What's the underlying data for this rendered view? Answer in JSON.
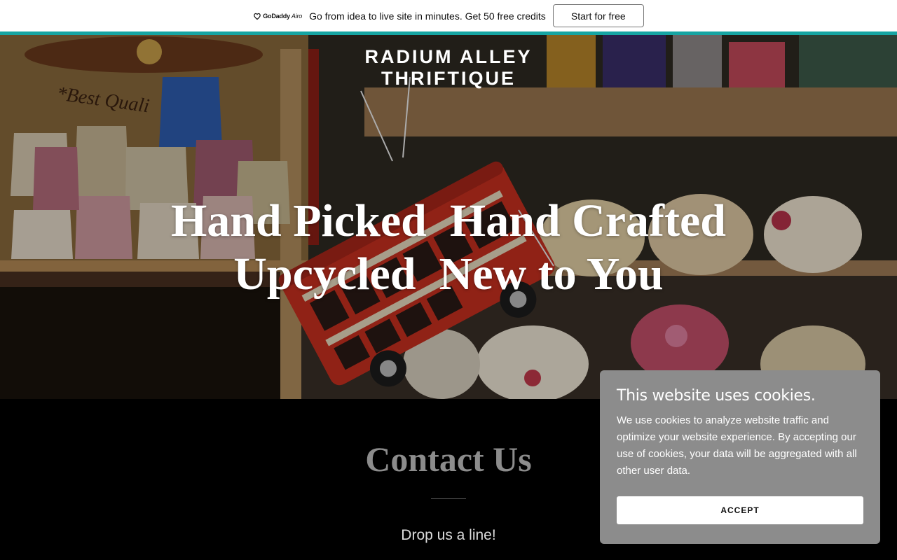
{
  "promo": {
    "logo_brand": "GoDaddy",
    "logo_product": "Airo",
    "text": "Go from idea to live site in minutes. Get 50 free credits",
    "button_label": "Start for free"
  },
  "hero": {
    "brand_line1": "RADIUM ALLEY",
    "brand_line2": "THRIFTIQUE",
    "title_line1": "Hand Picked  Hand Crafted",
    "title_line2": "Upcycled  New to You"
  },
  "contact": {
    "title": "Contact Us",
    "subtitle": "Drop us a line!"
  },
  "cookie": {
    "title": "This website uses cookies.",
    "body": "We use cookies to analyze website traffic and optimize your website experience. By accepting our use of cookies, your data will be aggregated with all other user data.",
    "accept_label": "ACCEPT"
  },
  "colors": {
    "accent_teal": "#16a5a3",
    "cookie_bg": "#8c8c8c",
    "bus_red": "#c8301f"
  }
}
